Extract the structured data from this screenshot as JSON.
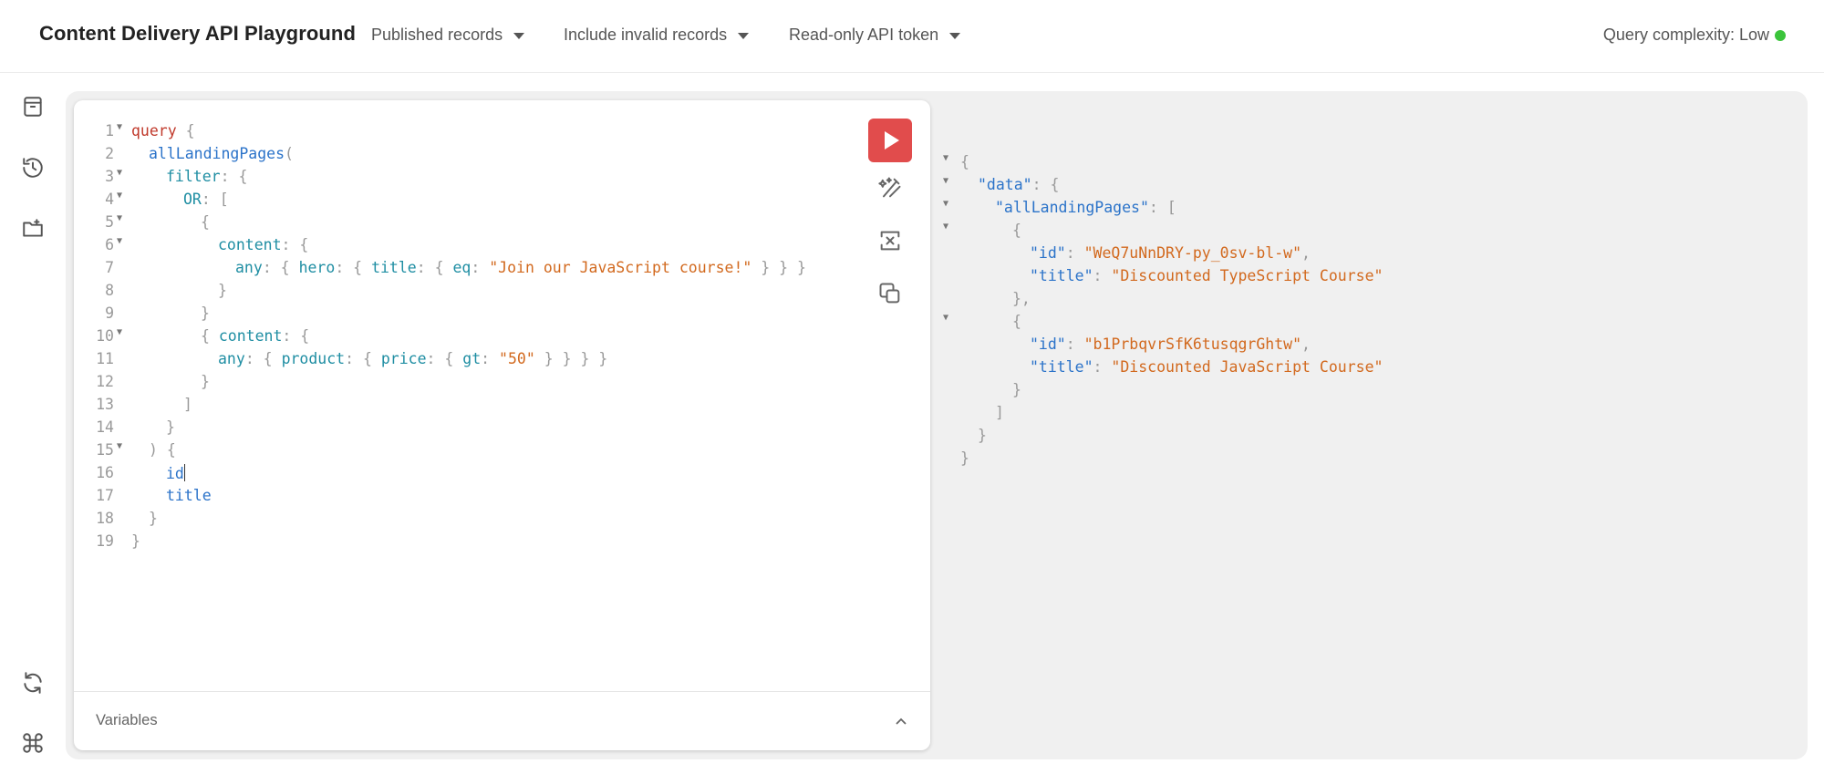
{
  "header": {
    "title": "Content Delivery API Playground",
    "dropdowns": [
      "Published records",
      "Include invalid records",
      "Read-only API token"
    ],
    "complexity_label": "Query complexity: Low",
    "complexity_color": "#3bc43b"
  },
  "rail": {
    "icons": [
      "archive-icon",
      "history-icon",
      "folder-plus-icon",
      "refresh-icon",
      "command-icon"
    ]
  },
  "editor": {
    "line_numbers": [
      "1",
      "2",
      "3",
      "4",
      "5",
      "6",
      "7",
      "8",
      "9",
      "10",
      "11",
      "12",
      "13",
      "14",
      "15",
      "16",
      "17",
      "18",
      "19"
    ],
    "variables_label": "Variables",
    "tools": [
      "prettify-icon",
      "merge-fragments-icon",
      "copy-icon"
    ],
    "code": {
      "l1_kw": "query",
      "l1_b": " {",
      "l2_fn": "allLandingPages",
      "l2_p": "(",
      "l3_arg": "filter",
      "l3_p": ": {",
      "l4_arg": "OR",
      "l4_p": ": [",
      "l5_p": "{",
      "l6_arg": "content",
      "l6_p": ": {",
      "l7_any": "any",
      "l7_p1": ": { ",
      "l7_hero": "hero",
      "l7_p2": ": { ",
      "l7_title": "title",
      "l7_p3": ": { ",
      "l7_eq": "eq",
      "l7_p4": ": ",
      "l7_str": "\"Join our JavaScript course!\"",
      "l7_p5": " } } }",
      "l8_p": "}",
      "l9_p": "}",
      "l10_p1": "{ ",
      "l10_arg": "content",
      "l10_p2": ": {",
      "l11_any": "any",
      "l11_p1": ": { ",
      "l11_product": "product",
      "l11_p2": ": { ",
      "l11_price": "price",
      "l11_p3": ": { ",
      "l11_gt": "gt",
      "l11_p4": ": ",
      "l11_str": "\"50\"",
      "l11_p5": " } } } }",
      "l12_p": "}",
      "l13_p": "]",
      "l14_p": "}",
      "l15_p": ") {",
      "l16_field": "id",
      "l17_field": "title",
      "l18_p": "}",
      "l19_p": "}"
    }
  },
  "result": {
    "r1": "{",
    "r2_key": "\"data\"",
    "r2_p": ": {",
    "r3_key": "\"allLandingPages\"",
    "r3_p": ": [",
    "r4": "{",
    "r5_key": "\"id\"",
    "r5_sep": ": ",
    "r5_val": "\"WeQ7uNnDRY-py_0sv-bl-w\"",
    "r5_end": ",",
    "r6_key": "\"title\"",
    "r6_sep": ": ",
    "r6_val": "\"Discounted TypeScript Course\"",
    "r7": "},",
    "r8": "{",
    "r9_key": "\"id\"",
    "r9_sep": ": ",
    "r9_val": "\"b1PrbqvrSfK6tusqgrGhtw\"",
    "r9_end": ",",
    "r10_key": "\"title\"",
    "r10_sep": ": ",
    "r10_val": "\"Discounted JavaScript Course\"",
    "r11": "}",
    "r12": "]",
    "r13": "}",
    "r14": "}"
  }
}
